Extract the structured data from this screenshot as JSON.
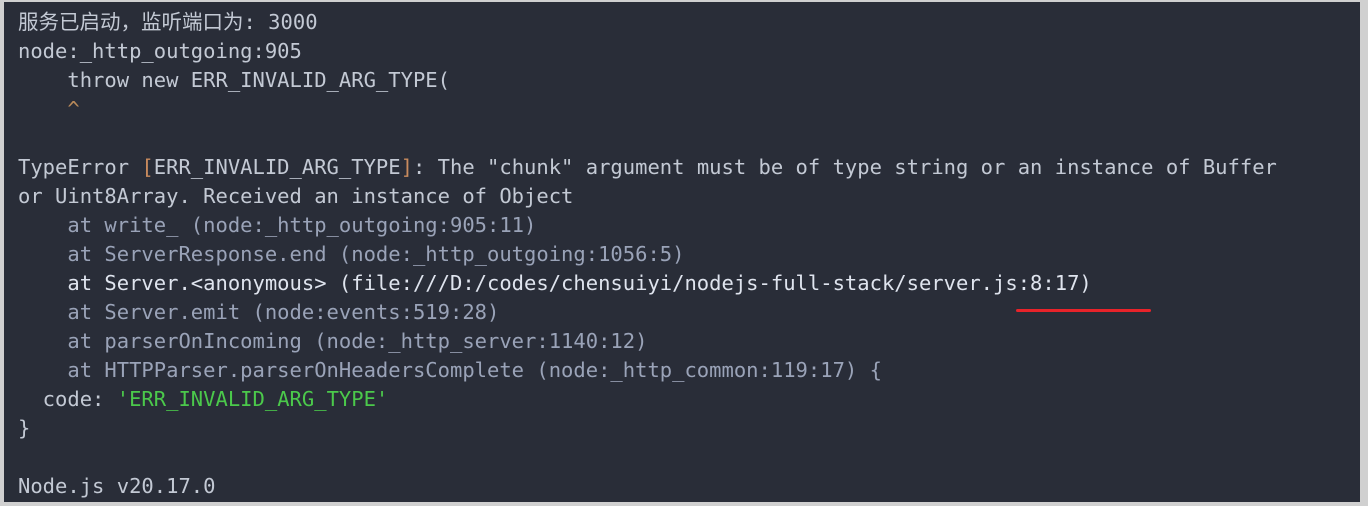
{
  "terminal": {
    "background_color": "#292d38",
    "text_color": "#c3c9d4",
    "dim_text_color": "#9aa3b8",
    "bright_text_color": "#dfe4ee",
    "string_color": "#4bc94b",
    "bracket_color": "#c98b5e",
    "annotation_color": "#e8232a",
    "server_startup_message": "服务已启动，监听端口为: 3000",
    "error_source_location": "node:_http_outgoing:905",
    "throw_statement": "    throw new ERR_INVALID_ARG_TYPE(",
    "caret_marker": "    ^",
    "blank_1": "",
    "error_headline_prefix": "TypeError ",
    "error_code_open_bracket": "[",
    "error_code_name": "ERR_INVALID_ARG_TYPE",
    "error_code_close_bracket": "]",
    "error_headline_suffix": ": The \"chunk\" argument must be of type string or an instance of Buffer",
    "error_headline_wrap": "or Uint8Array. Received an instance of Object",
    "stack": [
      "    at write_ (node:_http_outgoing:905:11)",
      "    at ServerResponse.end (node:_http_outgoing:1056:5)",
      "    at Server.<anonymous> (file:///D:/codes/chensuiyi/nodejs-full-stack/server.js:8:17)",
      "    at Server.emit (node:events:519:28)",
      "    at parserOnIncoming (node:_http_server:1140:12)",
      "    at HTTPParser.parserOnHeadersComplete (node:_http_common:119:17) {"
    ],
    "code_property_label": "  code: ",
    "code_property_value": "'ERR_INVALID_ARG_TYPE'",
    "object_close_brace": "}",
    "blank_2": "",
    "node_version_line": "Node.js v20.17.0",
    "annotation": {
      "type": "red-underline",
      "target_text": "server.js:8:17"
    }
  }
}
